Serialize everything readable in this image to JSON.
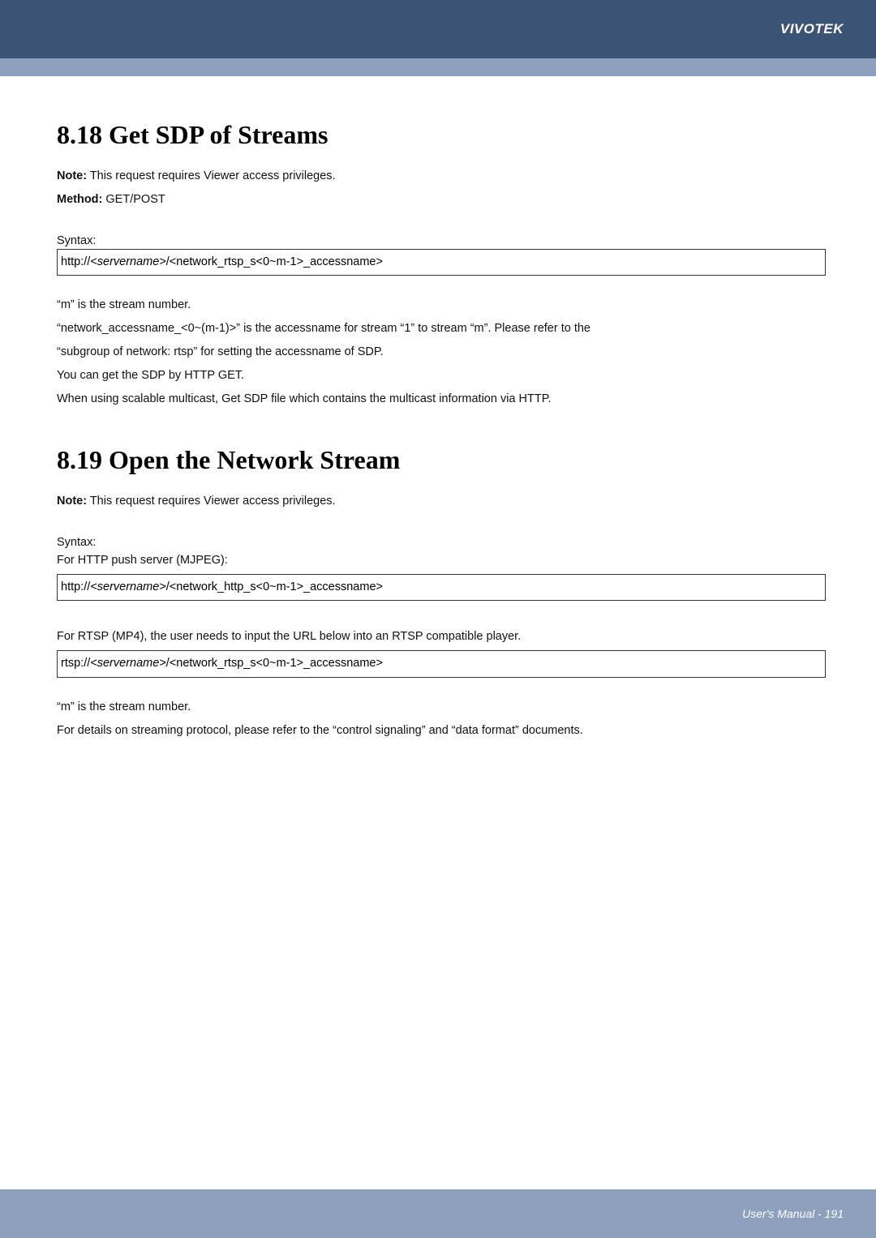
{
  "header": {
    "brand": "VIVOTEK"
  },
  "section1": {
    "heading": "8.18 Get SDP of Streams",
    "note_label": "Note:",
    "note_text": " This request requires Viewer access privileges.",
    "method_label": "Method:",
    "method_text": " GET/POST",
    "syntax_label": "Syntax:",
    "codebox": {
      "prefix": "http://",
      "server": "<servername>",
      "suffix": "/<network_rtsp_s<0~m-1>_accessname>"
    },
    "explain1": "“m” is the stream number.",
    "explain2": "“network_accessname_<0~(m-1)>” is the accessname for stream “1” to stream “m”. Please refer to the",
    "explain3": "“subgroup of network: rtsp” for setting the accessname of SDP.",
    "explain4": "You can get the SDP by HTTP GET.",
    "explain5": "When using scalable multicast, Get SDP file which contains the multicast information via HTTP."
  },
  "section2": {
    "heading": "8.19 Open the Network Stream",
    "note_label": "Note:",
    "note_text": " This request requires Viewer access privileges.",
    "syntax_label": "Syntax:",
    "http_label": "For HTTP push server (MJPEG):",
    "codebox_http": {
      "prefix": "http://",
      "server": "<servername>",
      "suffix": "/<network_http_s<0~m-1>_accessname>"
    },
    "rtsp_label": "For RTSP (MP4), the user needs to input the URL below into an RTSP compatible player.",
    "codebox_rtsp": {
      "prefix": "rtsp://",
      "server": "<servername>",
      "suffix": "/<network_rtsp_s<0~m-1>_accessname>"
    },
    "explain1": "“m” is the stream number.",
    "explain2": "For details on streaming protocol, please refer to the “control signaling” and “data format” documents."
  },
  "footer": {
    "text": "User's Manual - 191"
  }
}
